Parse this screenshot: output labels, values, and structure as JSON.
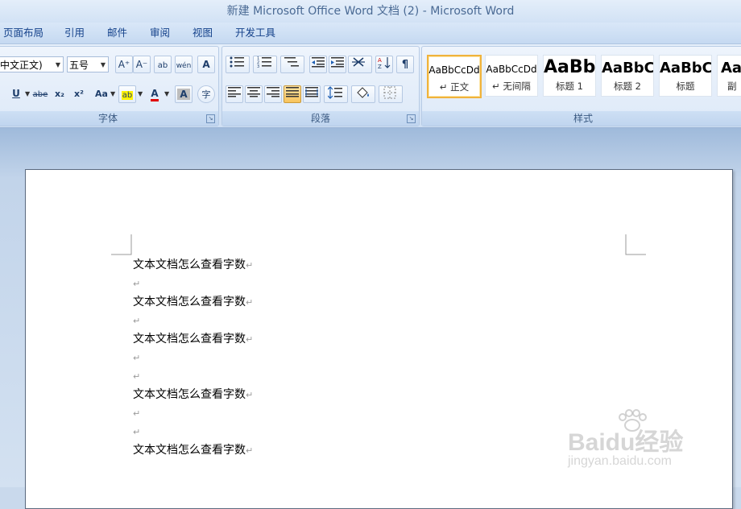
{
  "window": {
    "title": "新建 Microsoft Office Word 文档 (2) - Microsoft Word"
  },
  "menu": {
    "items": [
      {
        "label": "页面布局"
      },
      {
        "label": "引用"
      },
      {
        "label": "邮件"
      },
      {
        "label": "审阅"
      },
      {
        "label": "视图"
      },
      {
        "label": "开发工具"
      }
    ]
  },
  "ribbon": {
    "font_group": {
      "label": "字体",
      "font_name": "中文正文)",
      "font_size": "五号",
      "buttons": {
        "grow": "A⁺",
        "shrink": "A⁻",
        "clear": "ab",
        "phonetic": "wén",
        "border_char": "A",
        "underline": "U",
        "strike": "abe",
        "sub": "x₂",
        "sup": "x²",
        "case": "Aa",
        "highlight": "ab",
        "font_color": "A",
        "shading": "A",
        "enclose": "字"
      }
    },
    "paragraph_group": {
      "label": "段落"
    },
    "styles_group": {
      "label": "样式",
      "cards": [
        {
          "sample": "AaBbCcDd",
          "name": "↵ 正文",
          "selected": true
        },
        {
          "sample": "AaBbCcDd",
          "name": "↵ 无间隔",
          "selected": false
        },
        {
          "sample": "AaBb",
          "name": "标题 1",
          "selected": false
        },
        {
          "sample": "AaBbC",
          "name": "标题 2",
          "selected": false
        },
        {
          "sample": "AaBbC",
          "name": "标题",
          "selected": false
        },
        {
          "sample": "Aa",
          "name": "副",
          "selected": false
        }
      ]
    }
  },
  "document": {
    "lines": [
      {
        "text": "文本文档怎么查看字数",
        "mark": "↵"
      },
      {
        "text": "",
        "mark": "↵"
      },
      {
        "text": "文本文档怎么查看字数",
        "mark": "↵"
      },
      {
        "text": "",
        "mark": "↵"
      },
      {
        "text": "文本文档怎么查看字数",
        "mark": "↵"
      },
      {
        "text": "",
        "mark": "↵"
      },
      {
        "text": "",
        "mark": "↵"
      },
      {
        "text": "文本文档怎么查看字数",
        "mark": "↵"
      },
      {
        "text": "",
        "mark": "↵"
      },
      {
        "text": "",
        "mark": "↵"
      },
      {
        "text": "文本文档怎么查看字数",
        "mark": "↵"
      }
    ]
  },
  "watermark": {
    "brand": "Baidu经验",
    "url": "jingyan.baidu.com"
  },
  "colors": {
    "accent": "#15428b",
    "selected_style_border": "#f0b33c",
    "ribbon_bg": "#dbe8f7"
  }
}
